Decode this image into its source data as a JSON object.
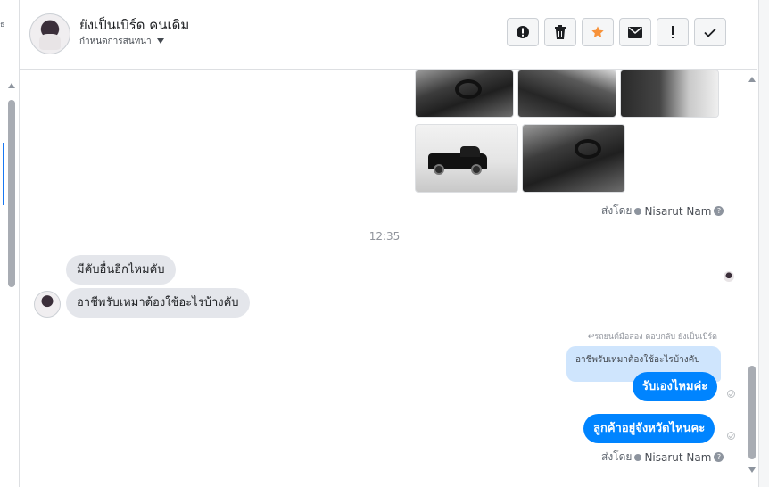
{
  "header": {
    "contact_name": "ยังเป็นเบิร์ด คนเดิม",
    "status_label": "กำหนดการสนทนา",
    "toolbar": [
      {
        "name": "report-icon"
      },
      {
        "name": "trash-icon"
      },
      {
        "name": "star-icon"
      },
      {
        "name": "mail-icon"
      },
      {
        "name": "exclamation-icon"
      },
      {
        "name": "check-icon"
      }
    ]
  },
  "messages": {
    "sent_by_label_1": "ส่งโดย",
    "sender_name_1": "Nisarut Nam",
    "timestamp": "12:35",
    "incoming": [
      "มีคับอื่นอีกไหมคับ",
      "อาชีพรับเหมาต้องใช้อะไรบ้างคับ"
    ],
    "reply_caption": "ตอบกลับ ยังเป็นเบิร์ด",
    "reply_caption_prefix": "รถยนต์มือสอง",
    "reply_quote": "อาชีพรับเหมาต้องใช้อะไรบ้างคับ",
    "outgoing": [
      "รับเองไหมค่ะ",
      "ลูกค้าอยู่จังหวัดไหนคะ"
    ],
    "sent_by_label_2": "ส่งโดย",
    "sender_name_2": "Nisarut Nam"
  },
  "colors": {
    "outgoing_bubble": "#0084ff",
    "incoming_bubble": "#e4e6eb",
    "star": "#f7923a",
    "quote_bg": "#cfe5fd"
  }
}
